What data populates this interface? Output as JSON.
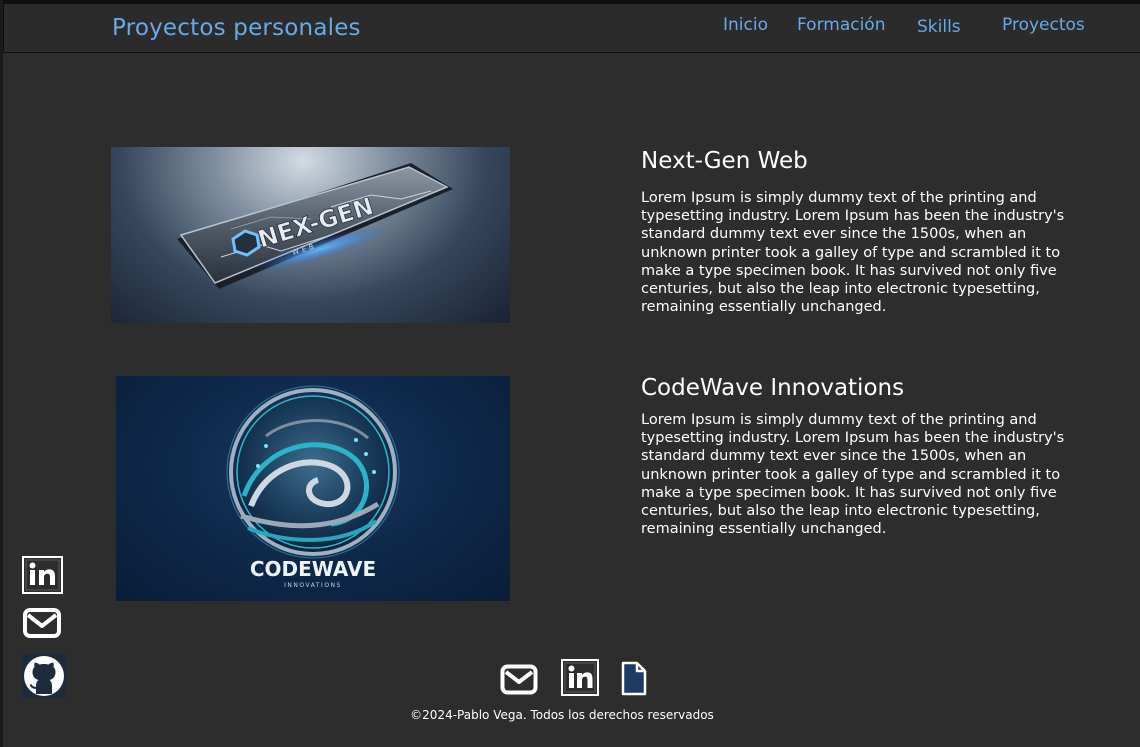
{
  "navbar": {
    "brand": "Proyectos personales",
    "links": [
      {
        "label": "Inicio"
      },
      {
        "label": "Formación"
      },
      {
        "label": "Skills"
      },
      {
        "label": "Proyectos"
      }
    ]
  },
  "projects": [
    {
      "title": "Next-Gen Web",
      "description": "Lorem Ipsum is simply dummy text of the printing and typesetting industry. Lorem Ipsum has been the industry's standard dummy text ever since the 1500s, when an unknown printer took a galley of  type and scrambled it to make a type specimen book. It has survived not  only five centuries, but also the leap into electronic typesetting,  remaining essentially unchanged.",
      "image_logo_text": "NEX-GEN",
      "image_sub_text": "WEB"
    },
    {
      "title": "CodeWave Innovations",
      "description": "Lorem Ipsum is simply dummy text of the printing and typesetting industry. Lorem Ipsum has been the industry's standard dummy text ever since the 1500s, when an unknown printer took a galley of  type and scrambled it to make a type specimen book. It has survived not  only five centuries, but also the leap into electronic typesetting,  remaining essentially unchanged.",
      "image_logo_text": "CODEWAVE",
      "image_sub_text": "INNOVATIONS"
    }
  ],
  "side_social": {
    "icons": [
      "linkedin-icon",
      "mail-icon",
      "github-icon"
    ]
  },
  "footer": {
    "icons": [
      "mail-icon",
      "linkedin-icon",
      "document-icon"
    ],
    "copyright": "©2024-Pablo Vega. Todos los derechos reservados"
  },
  "colors": {
    "background": "#2d2d2d",
    "navbar_background": "#2b2b2b",
    "accent_link": "#68a9e8",
    "text": "#ffffff"
  }
}
